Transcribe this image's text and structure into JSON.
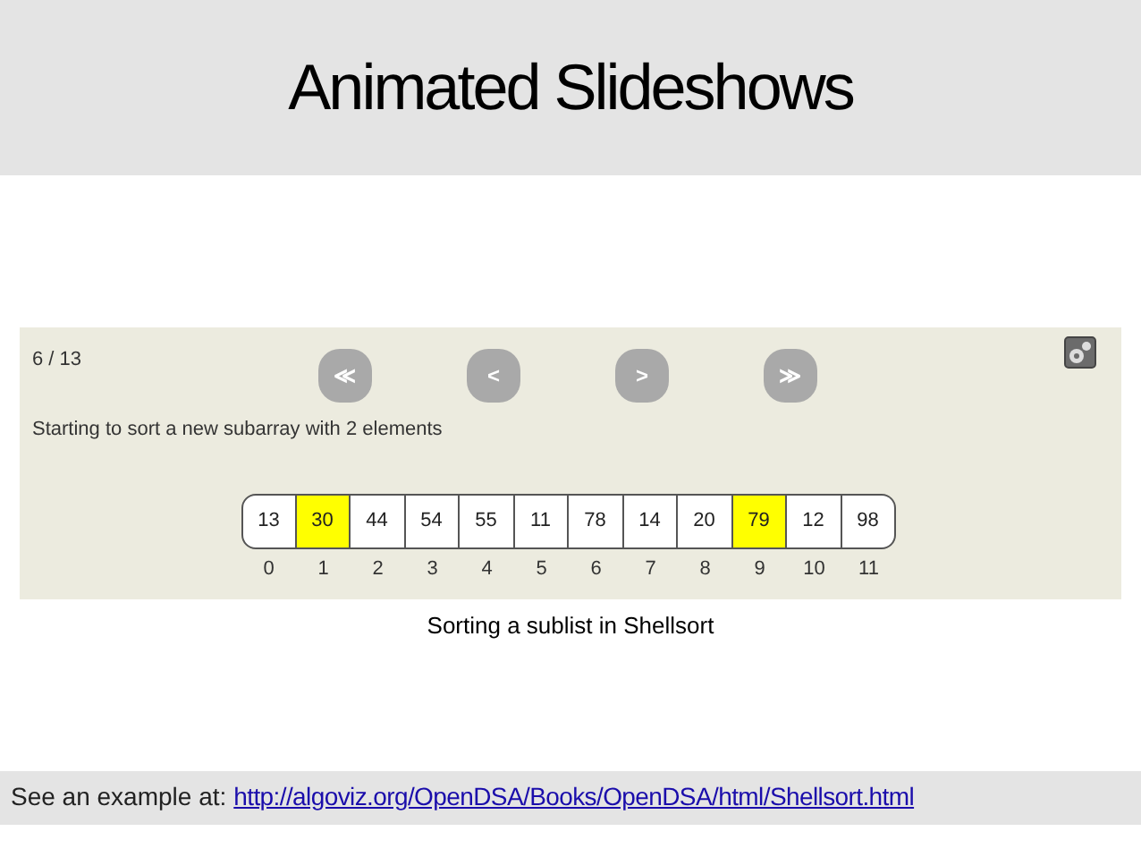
{
  "title": "Animated Slideshows",
  "slideshow": {
    "counter": "6 / 13",
    "buttons": [
      {
        "label": "≪"
      },
      {
        "label": "<"
      },
      {
        "label": ">"
      },
      {
        "label": "≫"
      }
    ],
    "message": "Starting to sort a new subarray with 2 elements",
    "cells": [
      {
        "value": "13",
        "index": "0",
        "highlighted": false
      },
      {
        "value": "30",
        "index": "1",
        "highlighted": true
      },
      {
        "value": "44",
        "index": "2",
        "highlighted": false
      },
      {
        "value": "54",
        "index": "3",
        "highlighted": false
      },
      {
        "value": "55",
        "index": "4",
        "highlighted": false
      },
      {
        "value": "11",
        "index": "5",
        "highlighted": false
      },
      {
        "value": "78",
        "index": "6",
        "highlighted": false
      },
      {
        "value": "14",
        "index": "7",
        "highlighted": false
      },
      {
        "value": "20",
        "index": "8",
        "highlighted": false
      },
      {
        "value": "79",
        "index": "9",
        "highlighted": true
      },
      {
        "value": "12",
        "index": "10",
        "highlighted": false
      },
      {
        "value": "98",
        "index": "11",
        "highlighted": false
      }
    ]
  },
  "caption": "Sorting a sublist in Shellsort",
  "footer": {
    "text": "See an example at:",
    "link": "http://algoviz.org/OpenDSA/Books/OpenDSA/html/Shellsort.html"
  }
}
